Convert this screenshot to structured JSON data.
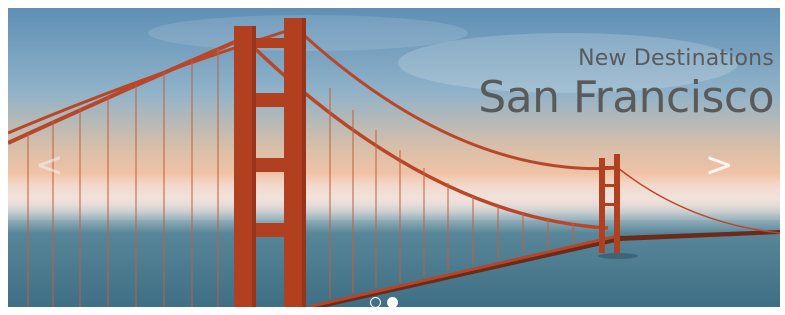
{
  "hero": {
    "subtitle": "New Destinations",
    "title": "San Francisco",
    "prev_icon": "chevron-left-icon",
    "next_icon": "chevron-right-icon",
    "prev_glyph": "<",
    "next_glyph": ">",
    "slides": [
      {
        "active": false
      },
      {
        "active": true
      }
    ]
  }
}
